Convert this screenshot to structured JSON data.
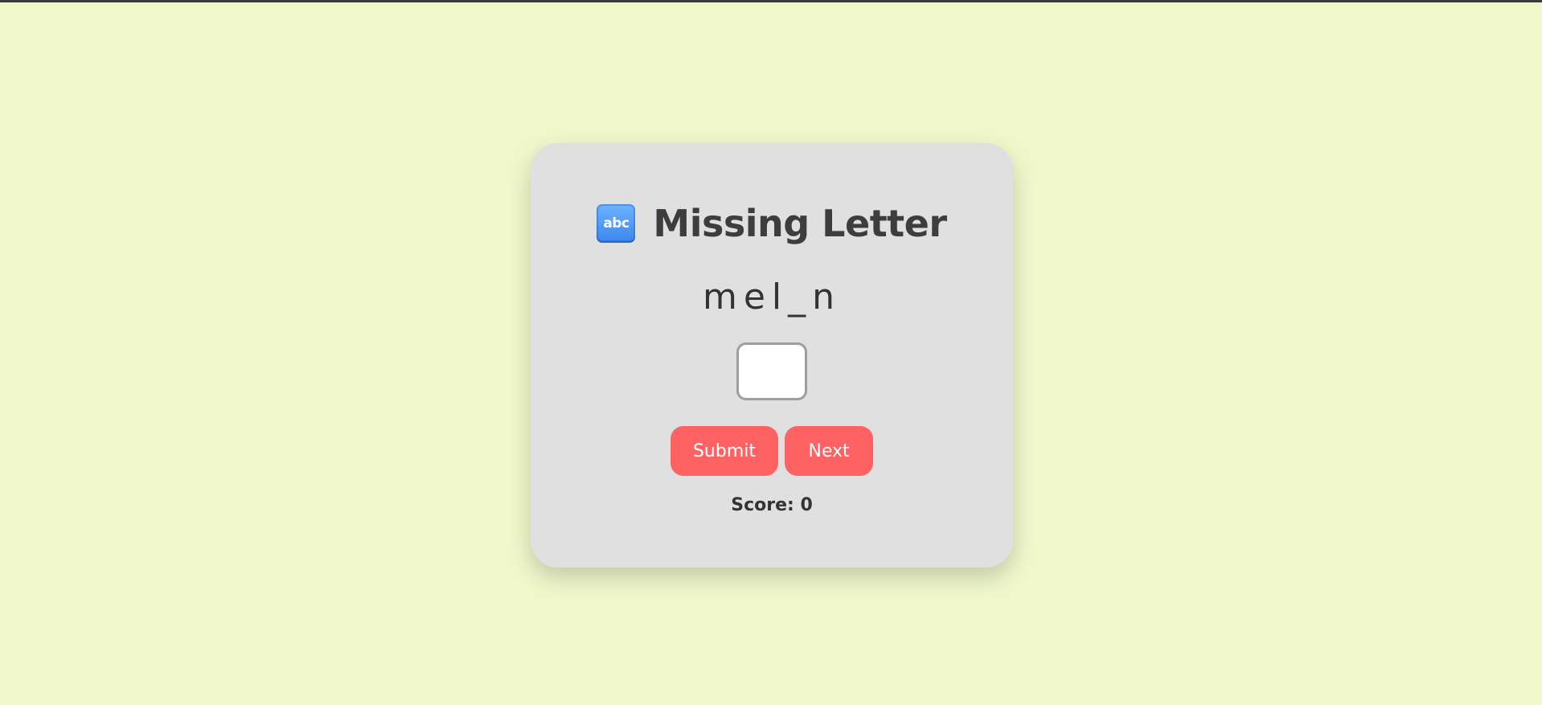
{
  "game": {
    "title": "Missing Letter",
    "title_icon": "abc",
    "title_icon_name": "abc-input-icon",
    "puzzle_word": "mel_n",
    "answer_value": "",
    "submit_label": "Submit",
    "next_label": "Next",
    "score_label": "Score: 0"
  },
  "colors": {
    "background": "#eff7cb",
    "card": "#e0e0e0",
    "button": "#fe6262",
    "text": "#3d3d3d"
  }
}
